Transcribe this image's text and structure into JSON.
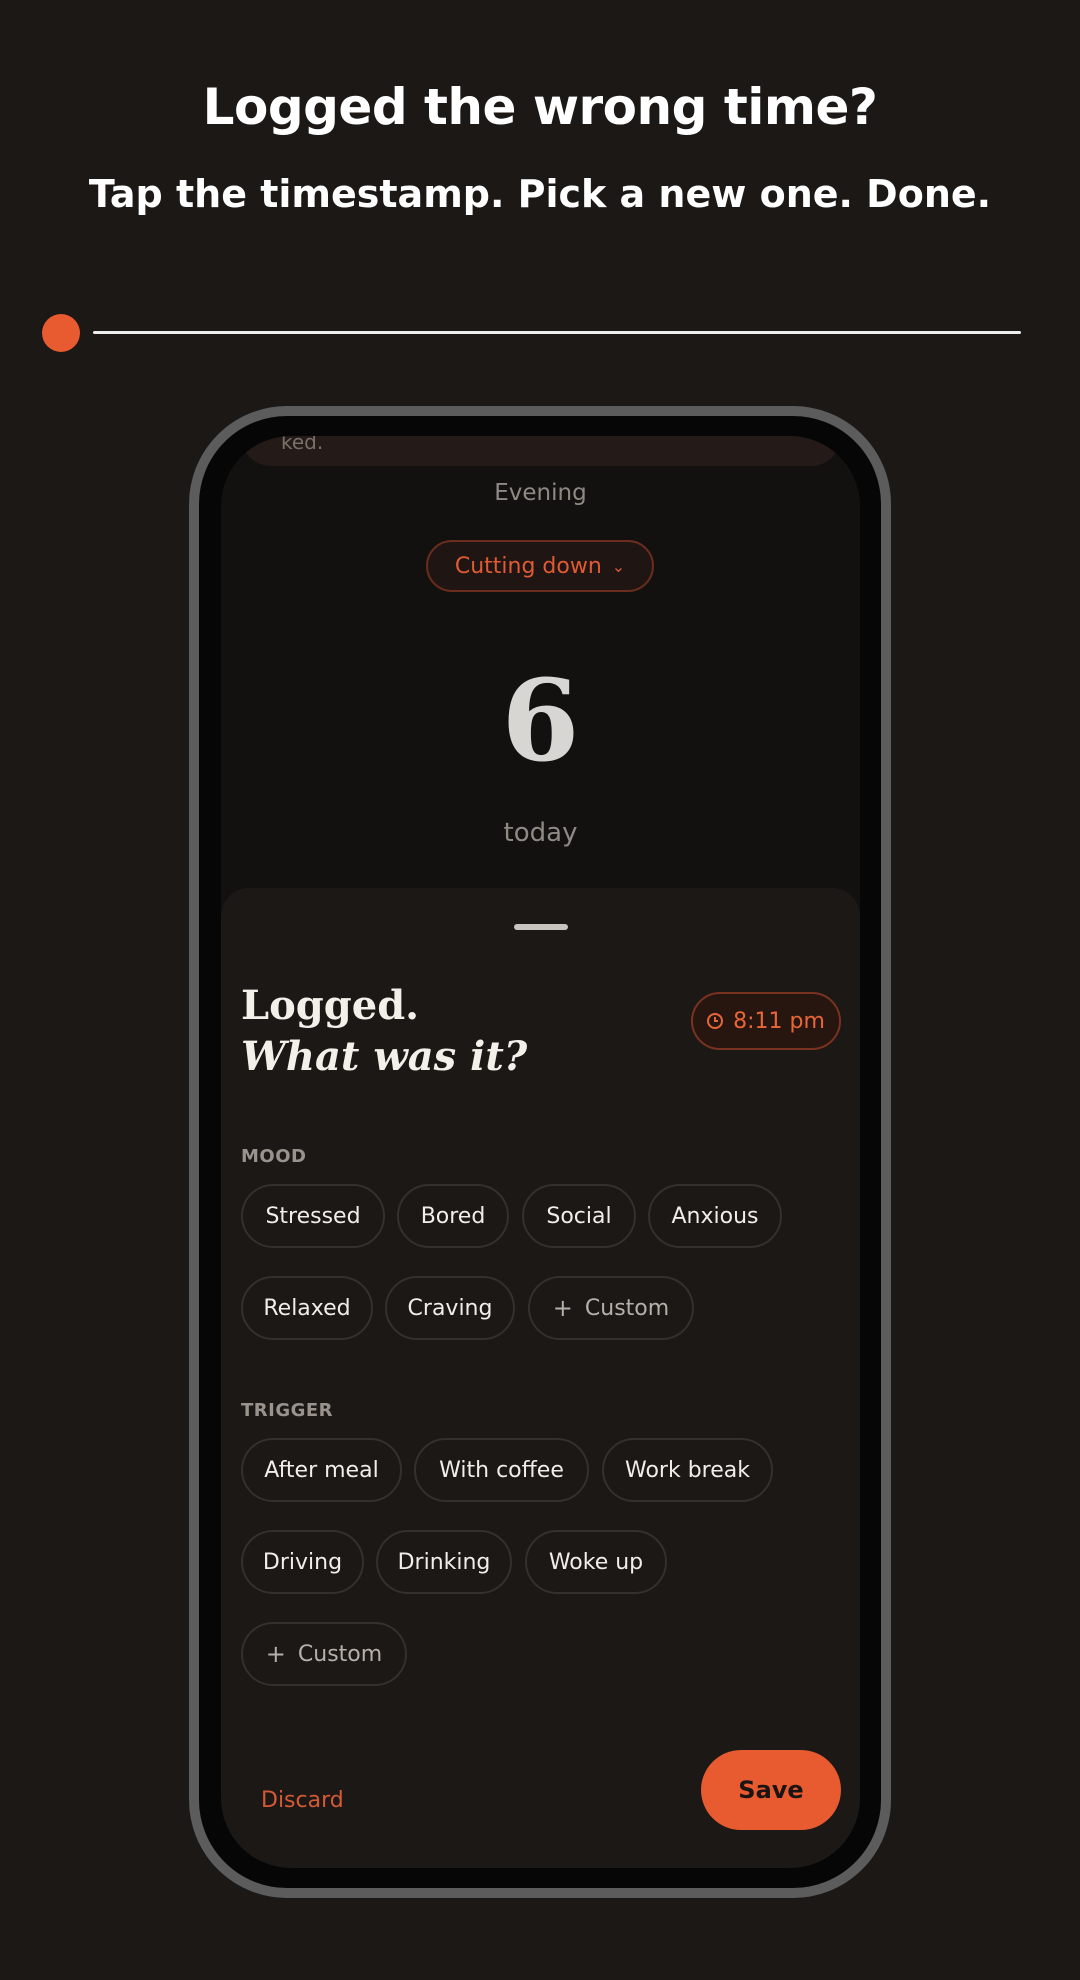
{
  "promo": {
    "headline": "Logged the wrong time?",
    "subline": "Tap the timestamp. Pick a new one. Done.",
    "accent_color": "#e85a30"
  },
  "screen": {
    "banner_text": "ked.",
    "period": "Evening",
    "goal": {
      "label": "Cutting down",
      "chevron": "⌄"
    },
    "count": {
      "value": "6",
      "label": "today"
    }
  },
  "sheet": {
    "title_line1": "Logged.",
    "title_line2": "What was it?",
    "time_pill": {
      "icon": "clock-icon",
      "label": "8:11 pm"
    },
    "mood": {
      "label": "MOOD",
      "chips": [
        "Stressed",
        "Bored",
        "Social",
        "Anxious",
        "Relaxed",
        "Craving"
      ],
      "custom": "Custom"
    },
    "trigger": {
      "label": "TRIGGER",
      "chips": [
        "After meal",
        "With coffee",
        "Work break",
        "Driving",
        "Drinking",
        "Woke up"
      ],
      "custom": "Custom"
    },
    "actions": {
      "discard": "Discard",
      "save": "Save"
    }
  }
}
